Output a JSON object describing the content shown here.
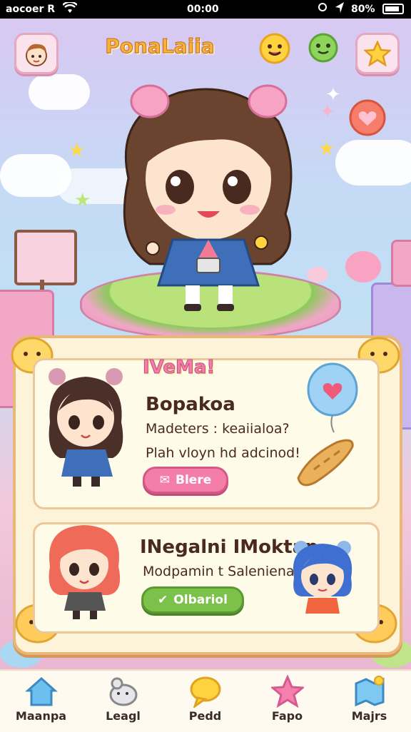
{
  "status_bar": {
    "carrier": "aocoer R",
    "time": "00:00",
    "battery": "80%"
  },
  "header": {
    "title": "PonaLaiia"
  },
  "cards": [
    {
      "badge": "IVeMa!",
      "title": "Bopakoa",
      "line1": "Madeters : keaiialoa?",
      "line2": "Plah vloyn hd adcinod!",
      "button": "Blere"
    },
    {
      "title": "INegalni IMoktap",
      "line1": "Modpamin t Saleniena?",
      "button": "Olbariol"
    }
  ],
  "nav": [
    {
      "label": "Maanpa",
      "icon": "house-icon"
    },
    {
      "label": "Leagl",
      "icon": "pet-icon"
    },
    {
      "label": "Pedd",
      "icon": "chat-bubble-icon"
    },
    {
      "label": "Fapo",
      "icon": "star-icon"
    },
    {
      "label": "Majrs",
      "icon": "map-icon"
    }
  ],
  "colors": {
    "accent_pink": "#f37fa8",
    "accent_green": "#7cc24a",
    "panel": "#fdf3d8"
  }
}
